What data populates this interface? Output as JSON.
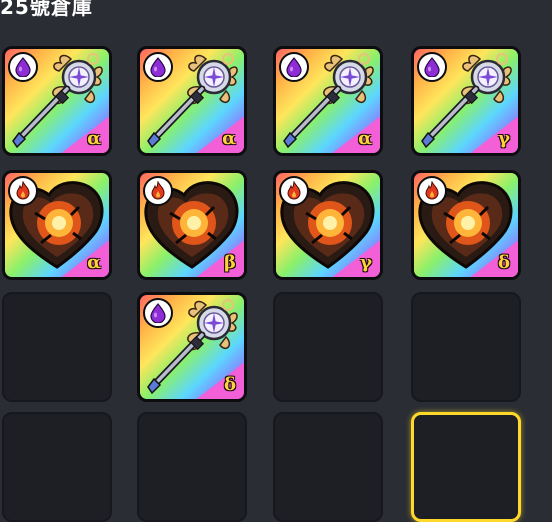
{
  "header": {
    "title": "25號倉庫"
  },
  "colors": {
    "rainbow_background": "#8af06a",
    "grade_corner": "#f25fd7",
    "grade_text": "#ffd23a",
    "empty_slot": "#1d1f25",
    "selected_border": "#ffd82a",
    "dark_element": "#8e2dd6",
    "fire_element": "#e23a1c"
  },
  "slots": [
    {
      "kind": "item",
      "item": "staff",
      "element": "dark",
      "element_icon": "dark-drop-icon",
      "grade": "α"
    },
    {
      "kind": "item",
      "item": "staff",
      "element": "dark",
      "element_icon": "dark-drop-icon",
      "grade": "α"
    },
    {
      "kind": "item",
      "item": "staff",
      "element": "dark",
      "element_icon": "dark-drop-icon",
      "grade": "α"
    },
    {
      "kind": "item",
      "item": "staff",
      "element": "dark",
      "element_icon": "dark-drop-icon",
      "grade": "γ"
    },
    {
      "kind": "item",
      "item": "heart",
      "element": "fire",
      "element_icon": "fire-icon",
      "grade": "α"
    },
    {
      "kind": "item",
      "item": "heart",
      "element": "fire",
      "element_icon": "fire-icon",
      "grade": "β"
    },
    {
      "kind": "item",
      "item": "heart",
      "element": "fire",
      "element_icon": "fire-icon",
      "grade": "γ"
    },
    {
      "kind": "item",
      "item": "heart",
      "element": "fire",
      "element_icon": "fire-icon",
      "grade": "δ"
    },
    {
      "kind": "empty"
    },
    {
      "kind": "item",
      "item": "staff",
      "element": "dark",
      "element_icon": "dark-drop-icon",
      "grade": "δ"
    },
    {
      "kind": "empty"
    },
    {
      "kind": "empty"
    },
    {
      "kind": "empty"
    },
    {
      "kind": "empty"
    },
    {
      "kind": "empty"
    },
    {
      "kind": "empty",
      "selected": true
    }
  ]
}
